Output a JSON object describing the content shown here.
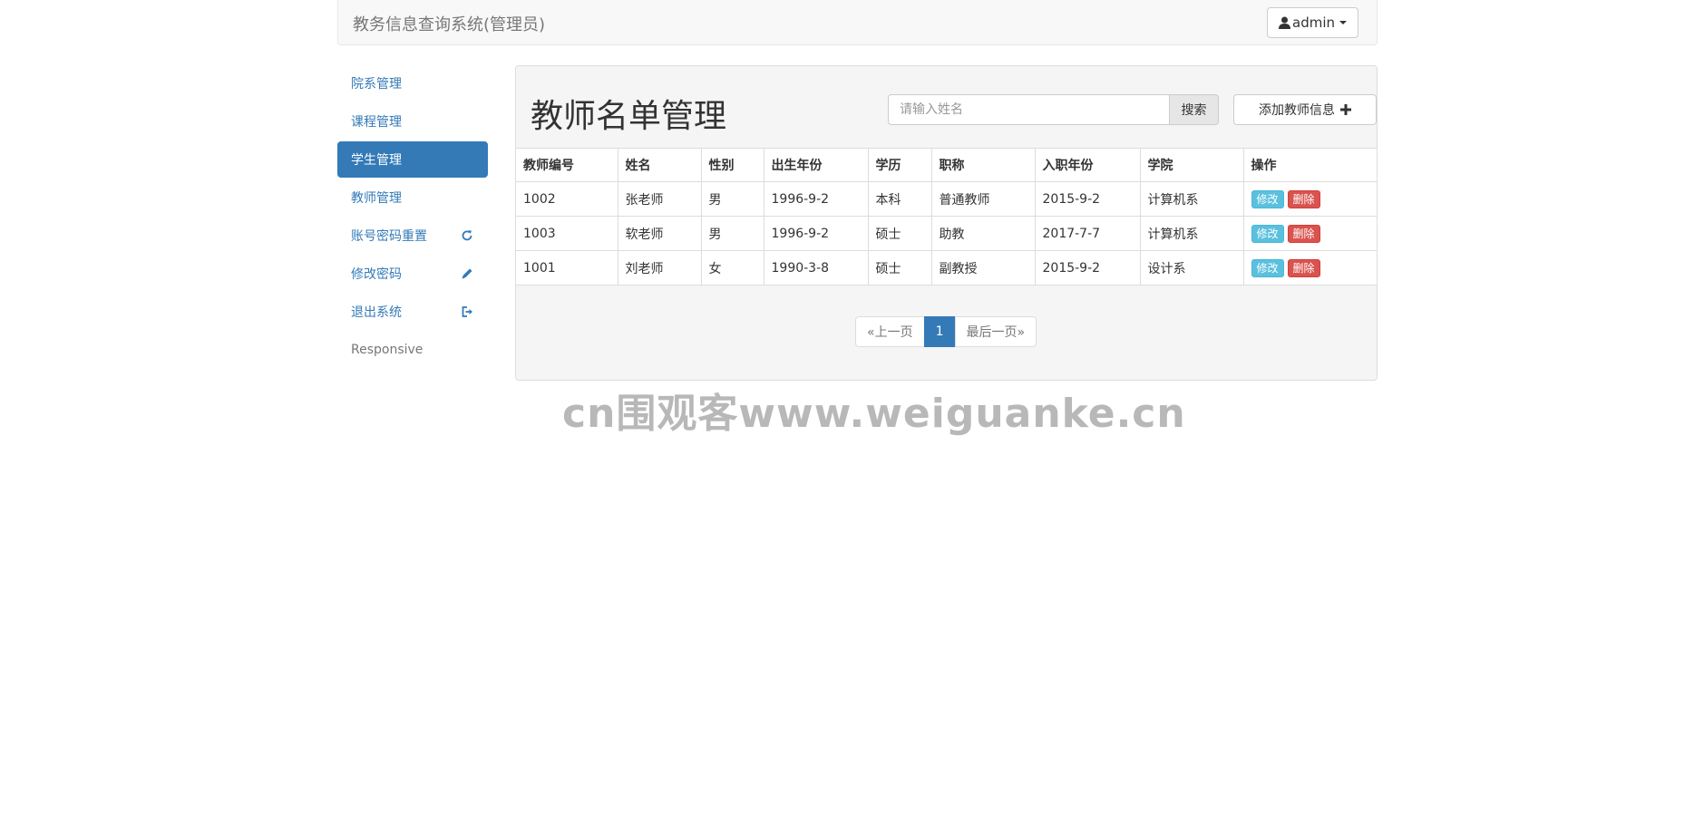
{
  "navbar": {
    "brand": "教务信息查询系统(管理员)",
    "user_label": "admin"
  },
  "sidebar": {
    "items": [
      {
        "label": "院系管理",
        "icon": ""
      },
      {
        "label": "课程管理",
        "icon": ""
      },
      {
        "label": "学生管理",
        "icon": "",
        "active": true
      },
      {
        "label": "教师管理",
        "icon": ""
      },
      {
        "label": "账号密码重置",
        "icon": "refresh-icon"
      },
      {
        "label": "修改密码",
        "icon": "pencil-icon"
      },
      {
        "label": "退出系统",
        "icon": "logout-icon"
      },
      {
        "label": "Responsive",
        "icon": ""
      }
    ]
  },
  "main": {
    "title": "教师名单管理",
    "search": {
      "placeholder": "请输入姓名",
      "button": "搜索"
    },
    "add_button": "添加教师信息"
  },
  "table": {
    "headers": [
      "教师编号",
      "姓名",
      "性别",
      "出生年份",
      "学历",
      "职称",
      "入职年份",
      "学院",
      "操作"
    ],
    "rows": [
      [
        "1002",
        "张老师",
        "男",
        "1996-9-2",
        "本科",
        "普通教师",
        "2015-9-2",
        "计算机系"
      ],
      [
        "1003",
        "软老师",
        "男",
        "1996-9-2",
        "硕士",
        "助教",
        "2017-7-7",
        "计算机系"
      ],
      [
        "1001",
        "刘老师",
        "女",
        "1990-3-8",
        "硕士",
        "副教授",
        "2015-9-2",
        "设计系"
      ]
    ],
    "edit_label": "修改",
    "delete_label": "删除"
  },
  "pagination": {
    "prev": "«上一页",
    "current": "1",
    "last": "最后一页»"
  },
  "watermark": "cn围观客www.weiguanke.cn",
  "colors": {
    "primary": "#337ab7",
    "info": "#5bc0de",
    "danger": "#d9534f"
  }
}
